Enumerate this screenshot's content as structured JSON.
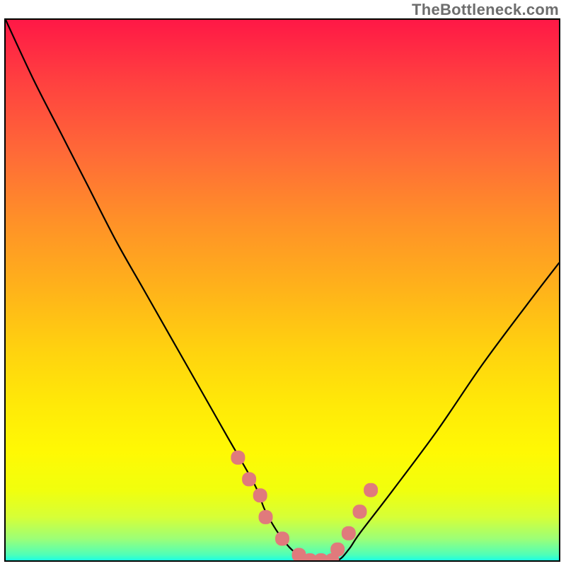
{
  "watermark": "TheBottleneck.com",
  "chart_data": {
    "type": "line",
    "title": "",
    "xlabel": "",
    "ylabel": "",
    "xlim": [
      0,
      100
    ],
    "ylim": [
      0,
      100
    ],
    "series": [
      {
        "name": "curve",
        "x": [
          0,
          5,
          10,
          15,
          20,
          25,
          30,
          35,
          40,
          45,
          47,
          50,
          53,
          57,
          60,
          62,
          64,
          70,
          78,
          86,
          94,
          100
        ],
        "y": [
          100,
          89,
          79,
          69,
          59,
          50,
          41,
          32,
          23,
          14,
          9,
          4,
          1,
          0,
          0,
          2,
          5,
          13,
          24,
          36,
          47,
          55
        ]
      }
    ],
    "markers": {
      "name": "nodes",
      "color": "#e07a7c",
      "x": [
        42,
        44,
        46,
        47,
        50,
        53,
        55,
        57,
        59,
        60,
        62,
        64,
        66
      ],
      "y": [
        19,
        15,
        12,
        8,
        4,
        1,
        0,
        0,
        0,
        2,
        5,
        9,
        13
      ]
    },
    "background_gradient": {
      "stops": [
        {
          "offset": 0,
          "color": "#ff1846"
        },
        {
          "offset": 25,
          "color": "#ff6b37"
        },
        {
          "offset": 50,
          "color": "#ffb31a"
        },
        {
          "offset": 71,
          "color": "#ffe908"
        },
        {
          "offset": 92,
          "color": "#d6ff37"
        },
        {
          "offset": 100,
          "color": "#1bffe1"
        }
      ]
    }
  }
}
